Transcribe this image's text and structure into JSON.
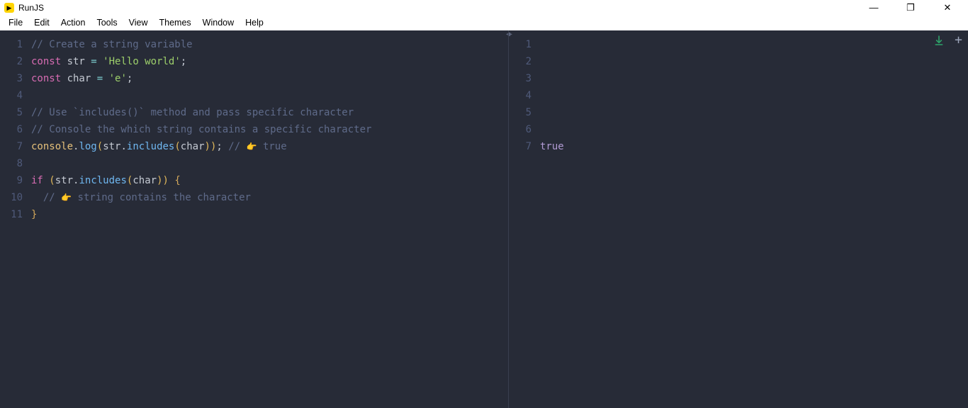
{
  "app": {
    "title": "RunJS",
    "icon_glyph": "▶"
  },
  "window_controls": {
    "minimize": "—",
    "maximize": "❐",
    "close": "✕"
  },
  "menu": [
    "File",
    "Edit",
    "Action",
    "Tools",
    "View",
    "Themes",
    "Window",
    "Help"
  ],
  "editor": {
    "lines": [
      {
        "n": 1,
        "tokens": [
          {
            "t": "// Create a string variable",
            "c": "c-comment"
          }
        ]
      },
      {
        "n": 2,
        "tokens": [
          {
            "t": "const ",
            "c": "c-keyword"
          },
          {
            "t": "str",
            "c": "c-var"
          },
          {
            "t": " = ",
            "c": "c-op"
          },
          {
            "t": "'Hello world'",
            "c": "c-string"
          },
          {
            "t": ";",
            "c": "c-punc"
          }
        ]
      },
      {
        "n": 3,
        "tokens": [
          {
            "t": "const ",
            "c": "c-keyword"
          },
          {
            "t": "char",
            "c": "c-var"
          },
          {
            "t": " = ",
            "c": "c-op"
          },
          {
            "t": "'e'",
            "c": "c-string"
          },
          {
            "t": ";",
            "c": "c-punc"
          }
        ]
      },
      {
        "n": 4,
        "tokens": [
          {
            "t": "",
            "c": ""
          }
        ]
      },
      {
        "n": 5,
        "tokens": [
          {
            "t": "// Use `includes()` method and pass specific character",
            "c": "c-comment"
          }
        ]
      },
      {
        "n": 6,
        "tokens": [
          {
            "t": "// Console the which string contains a specific character",
            "c": "c-comment"
          }
        ]
      },
      {
        "n": 7,
        "tokens": [
          {
            "t": "console",
            "c": "c-ident"
          },
          {
            "t": ".",
            "c": "c-punc"
          },
          {
            "t": "log",
            "c": "c-func"
          },
          {
            "t": "(",
            "c": "c-paren"
          },
          {
            "t": "str",
            "c": "c-var"
          },
          {
            "t": ".",
            "c": "c-punc"
          },
          {
            "t": "includes",
            "c": "c-func"
          },
          {
            "t": "(",
            "c": "c-paren"
          },
          {
            "t": "char",
            "c": "c-var"
          },
          {
            "t": ")",
            "c": "c-paren"
          },
          {
            "t": ")",
            "c": "c-paren"
          },
          {
            "t": ";",
            "c": "c-punc"
          },
          {
            "t": " ",
            "c": ""
          },
          {
            "t": "// ",
            "c": "c-comment"
          },
          {
            "t": "👉",
            "c": "emoji"
          },
          {
            "t": " true",
            "c": "c-comment"
          }
        ]
      },
      {
        "n": 8,
        "tokens": [
          {
            "t": "",
            "c": ""
          }
        ]
      },
      {
        "n": 9,
        "tokens": [
          {
            "t": "if ",
            "c": "c-keyword"
          },
          {
            "t": "(",
            "c": "c-paren"
          },
          {
            "t": "str",
            "c": "c-var"
          },
          {
            "t": ".",
            "c": "c-punc"
          },
          {
            "t": "includes",
            "c": "c-func"
          },
          {
            "t": "(",
            "c": "c-paren"
          },
          {
            "t": "char",
            "c": "c-var"
          },
          {
            "t": ")",
            "c": "c-paren"
          },
          {
            "t": ")",
            "c": "c-paren"
          },
          {
            "t": " ",
            "c": ""
          },
          {
            "t": "{",
            "c": "c-brace"
          }
        ]
      },
      {
        "n": 10,
        "tokens": [
          {
            "t": "  ",
            "c": ""
          },
          {
            "t": "// ",
            "c": "c-comment"
          },
          {
            "t": "👉",
            "c": "emoji"
          },
          {
            "t": " string contains the character",
            "c": "c-comment"
          }
        ]
      },
      {
        "n": 11,
        "tokens": [
          {
            "t": "}",
            "c": "c-brace"
          }
        ]
      }
    ]
  },
  "output": {
    "lines": [
      {
        "n": 1,
        "text": ""
      },
      {
        "n": 2,
        "text": ""
      },
      {
        "n": 3,
        "text": ""
      },
      {
        "n": 4,
        "text": ""
      },
      {
        "n": 5,
        "text": ""
      },
      {
        "n": 6,
        "text": ""
      },
      {
        "n": 7,
        "text": "true"
      }
    ]
  }
}
